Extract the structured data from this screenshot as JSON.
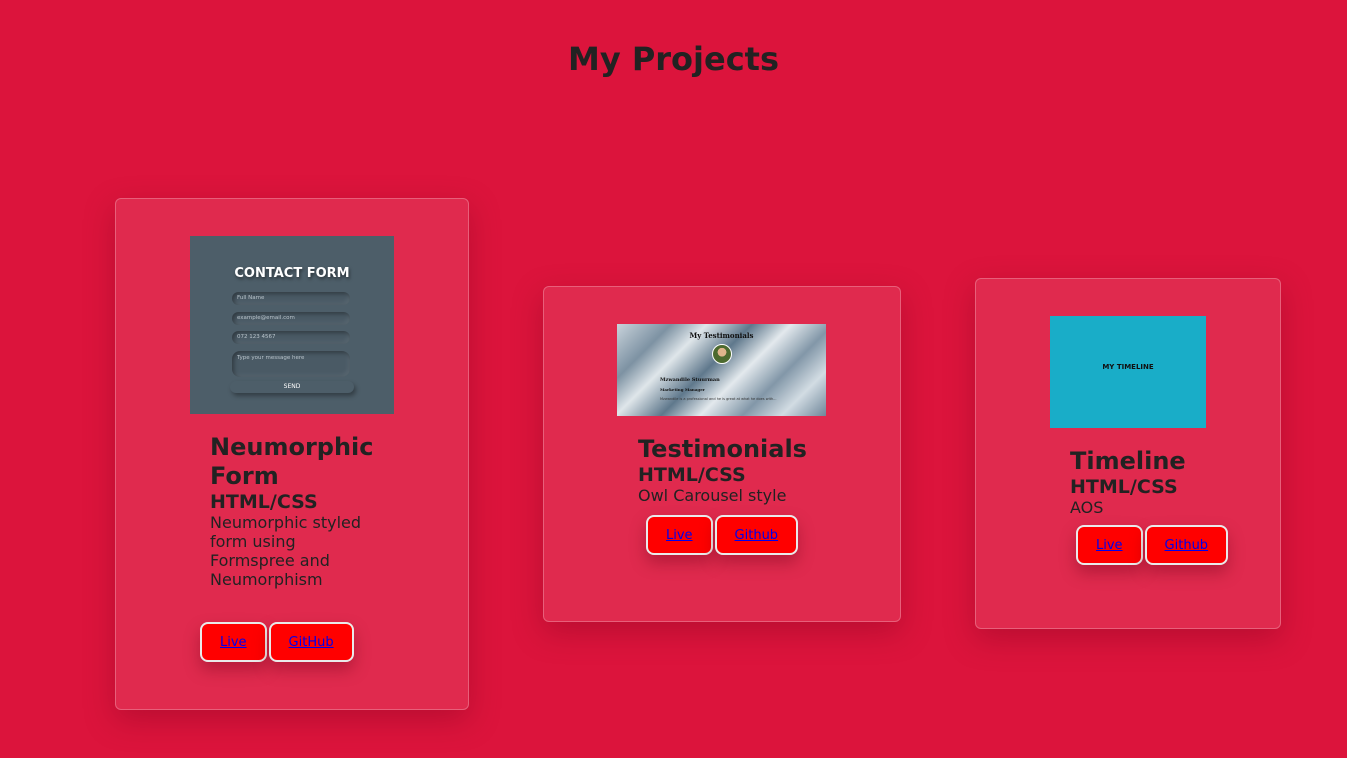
{
  "page": {
    "title": "My Projects"
  },
  "projects": [
    {
      "name": "Neumorphic Form",
      "tech": "HTML/CSS",
      "description": "Neumorphic styled form using Formspree and Neumorphism",
      "live_label": "Live",
      "code_label": "GitHub",
      "thumbnail": {
        "title": "CONTACT FORM",
        "fields": [
          "Full Name",
          "example@email.com",
          "072 123 4567",
          "Type your message here"
        ],
        "button": "SEND",
        "background": "#4d5e69"
      }
    },
    {
      "name": "Testimonials",
      "tech": "HTML/CSS",
      "description": "Owl Carousel style",
      "live_label": "Live",
      "code_label": "Github",
      "thumbnail": {
        "title": "My Testimonials",
        "person": "Mzwandile Stuurman",
        "role": "Marketing Manager",
        "quote": "Mzwandile is a professional and he is great at what he does with..."
      }
    },
    {
      "name": "Timeline",
      "tech": "HTML/CSS",
      "description": "AOS",
      "live_label": "Live",
      "code_label": "Github",
      "thumbnail": {
        "title": "MY TIMELINE",
        "background": "#19adc8"
      }
    }
  ],
  "colors": {
    "page_background": "#dc143c",
    "card_background": "#e02a4e",
    "button_background": "#ff0000",
    "link_color": "#0000ee"
  }
}
